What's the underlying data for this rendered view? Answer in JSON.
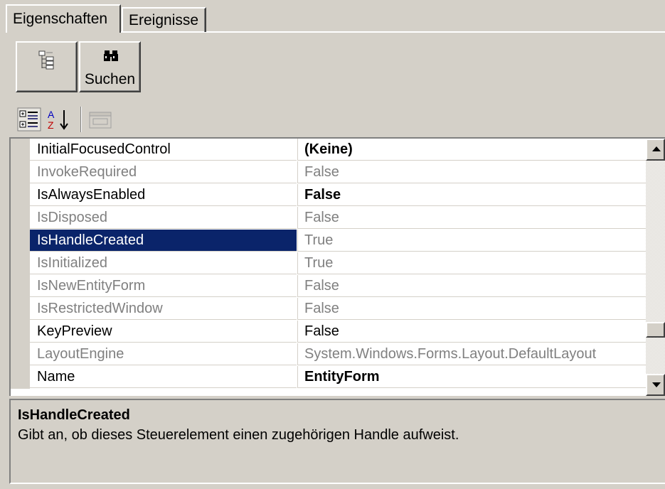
{
  "tabs": [
    {
      "label": "Eigenschaften",
      "active": true
    },
    {
      "label": "Ereignisse",
      "active": false
    }
  ],
  "toolbar": {
    "tree_icon": "tree-view-icon",
    "search_label": "Suchen",
    "search_icon": "binoculars-icon",
    "categorized_icon": "categorized-icon",
    "alphabetical_icon": "sort-alphabetical-icon",
    "property_pages_icon": "property-pages-icon"
  },
  "grid": {
    "rows": [
      {
        "name": "InitialFocusedControl",
        "value": "(Keine)",
        "readonly": false,
        "bold": true,
        "selected": false
      },
      {
        "name": "InvokeRequired",
        "value": "False",
        "readonly": true,
        "bold": false,
        "selected": false
      },
      {
        "name": "IsAlwaysEnabled",
        "value": "False",
        "readonly": false,
        "bold": true,
        "selected": false
      },
      {
        "name": "IsDisposed",
        "value": "False",
        "readonly": true,
        "bold": false,
        "selected": false
      },
      {
        "name": "IsHandleCreated",
        "value": "True",
        "readonly": true,
        "bold": false,
        "selected": true
      },
      {
        "name": "IsInitialized",
        "value": "True",
        "readonly": true,
        "bold": false,
        "selected": false
      },
      {
        "name": "IsNewEntityForm",
        "value": "False",
        "readonly": true,
        "bold": false,
        "selected": false
      },
      {
        "name": "IsRestrictedWindow",
        "value": "False",
        "readonly": true,
        "bold": false,
        "selected": false
      },
      {
        "name": "KeyPreview",
        "value": "False",
        "readonly": false,
        "bold": false,
        "selected": false
      },
      {
        "name": "LayoutEngine",
        "value": "System.Windows.Forms.Layout.DefaultLayout",
        "readonly": true,
        "bold": false,
        "selected": false
      },
      {
        "name": "Name",
        "value": "EntityForm",
        "readonly": false,
        "bold": true,
        "selected": false
      }
    ]
  },
  "description": {
    "title": "IsHandleCreated",
    "text": "Gibt an, ob dieses Steuerelement einen zugehörigen Handle aufweist."
  },
  "colors": {
    "face": "#d4d0c8",
    "selection": "#0a246a",
    "readonly_text": "#808080"
  }
}
